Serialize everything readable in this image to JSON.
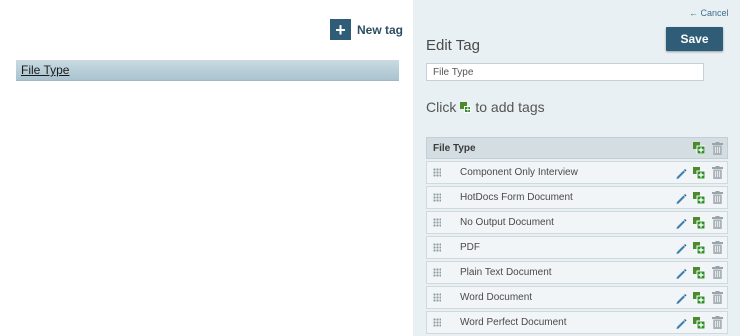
{
  "left": {
    "new_tag_label": "New tag",
    "new_tag_icon": "plus-icon",
    "tags": [
      {
        "label": "File Type"
      }
    ]
  },
  "editor": {
    "cancel_label": "← Cancel",
    "title": "Edit Tag",
    "save_label": "Save",
    "name_value": "File Type",
    "hint_before": "Click",
    "hint_after": "to add tags",
    "group_header": "File Type",
    "items": [
      "Component Only Interview",
      "HotDocs Form Document",
      "No Output Document",
      "PDF",
      "Plain Text Document",
      "Word Document",
      "Word Perfect Document"
    ]
  },
  "colors": {
    "accent": "#2f5d78",
    "panel_bg": "#e8f0f3",
    "selected_row": "#b5ccd7",
    "add_green": "#2f8f2a",
    "edit_blue": "#3d7fb1"
  }
}
